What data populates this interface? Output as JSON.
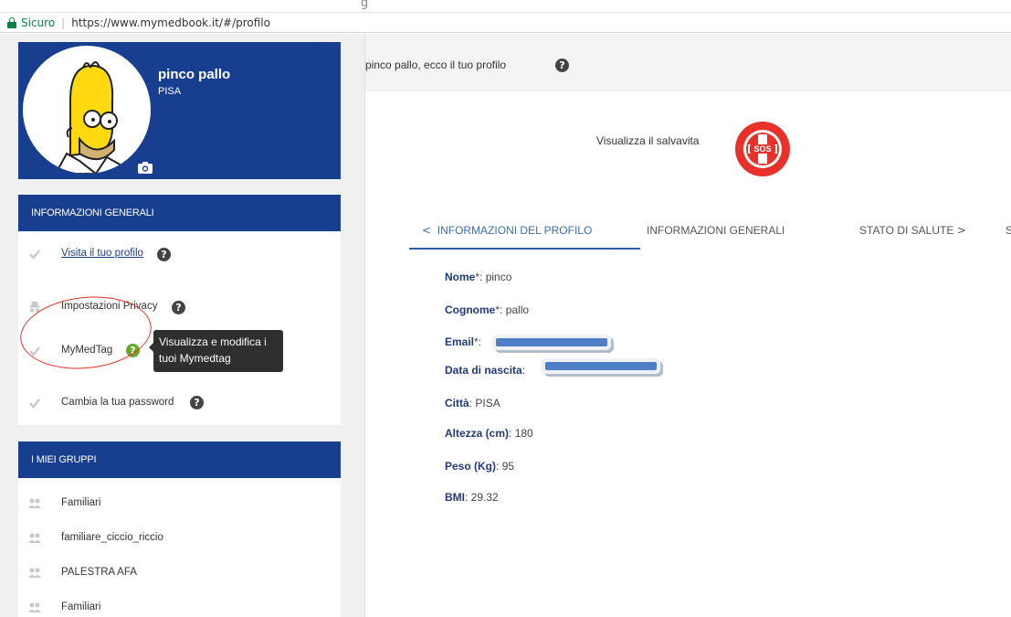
{
  "browser": {
    "secure_label": "Sicuro",
    "url": "https://www.mymedbook.it/#/profilo"
  },
  "profile": {
    "name": "pinco pallo",
    "city": "PISA"
  },
  "info_panel": {
    "header": "INFORMAZIONI GENERALI",
    "items": [
      {
        "label": "Visita il tuo profilo",
        "icon": "check-icon"
      },
      {
        "label": "Impostazioni Privacy",
        "icon": "incognito-icon"
      },
      {
        "label": "MyMedTag",
        "icon": "check-icon"
      },
      {
        "label": "Cambia la tua password",
        "icon": "check-icon"
      }
    ],
    "tooltip": "Visualizza e modifica i tuoi Mymedtag"
  },
  "groups_panel": {
    "header": "I MIEI GRUPPI",
    "items": [
      {
        "label": "Familiari",
        "icon": "users-icon"
      },
      {
        "label": "familiare_ciccio_riccio",
        "icon": "users-icon"
      },
      {
        "label": "PALESTRA AFA",
        "icon": "users-icon"
      },
      {
        "label": "Familiari",
        "icon": "users-icon"
      }
    ]
  },
  "main": {
    "header_title": "pinco pallo, ecco il tuo profilo",
    "sos_label": "Visualizza il salvavita",
    "sos_badge_text": "SOS",
    "tabs": [
      {
        "label": "INFORMAZIONI DEL PROFILO",
        "prefix": "<",
        "active": true
      },
      {
        "label": "INFORMAZIONI GENERALI",
        "active": false
      },
      {
        "label": "STATO DI SALUTE",
        "suffix": ">",
        "active": false
      },
      {
        "label": "S",
        "active": false
      }
    ],
    "fields": [
      {
        "key": "Nome",
        "suffix": "*:",
        "value": " pinco"
      },
      {
        "key": "Cognome",
        "suffix": "*:",
        "value": " pallo"
      },
      {
        "key": "Email",
        "suffix": "*:",
        "value": ""
      },
      {
        "key": "Data di nascita",
        "suffix": ":",
        "value": ""
      },
      {
        "key": "Città",
        "suffix": ":",
        "value": " PISA"
      },
      {
        "key": "Altezza (cm)",
        "suffix": ":",
        "value": " 180"
      },
      {
        "key": "Peso (Kg)",
        "suffix": ":",
        "value": " 95"
      },
      {
        "key": "BMI",
        "suffix": ":",
        "value": " 29.32"
      }
    ]
  },
  "colors": {
    "brand_blue": "#183f8f",
    "help_green": "#6aa82c",
    "annotation_red": "#e8312a",
    "redaction_blue": "#4f7fc7"
  }
}
